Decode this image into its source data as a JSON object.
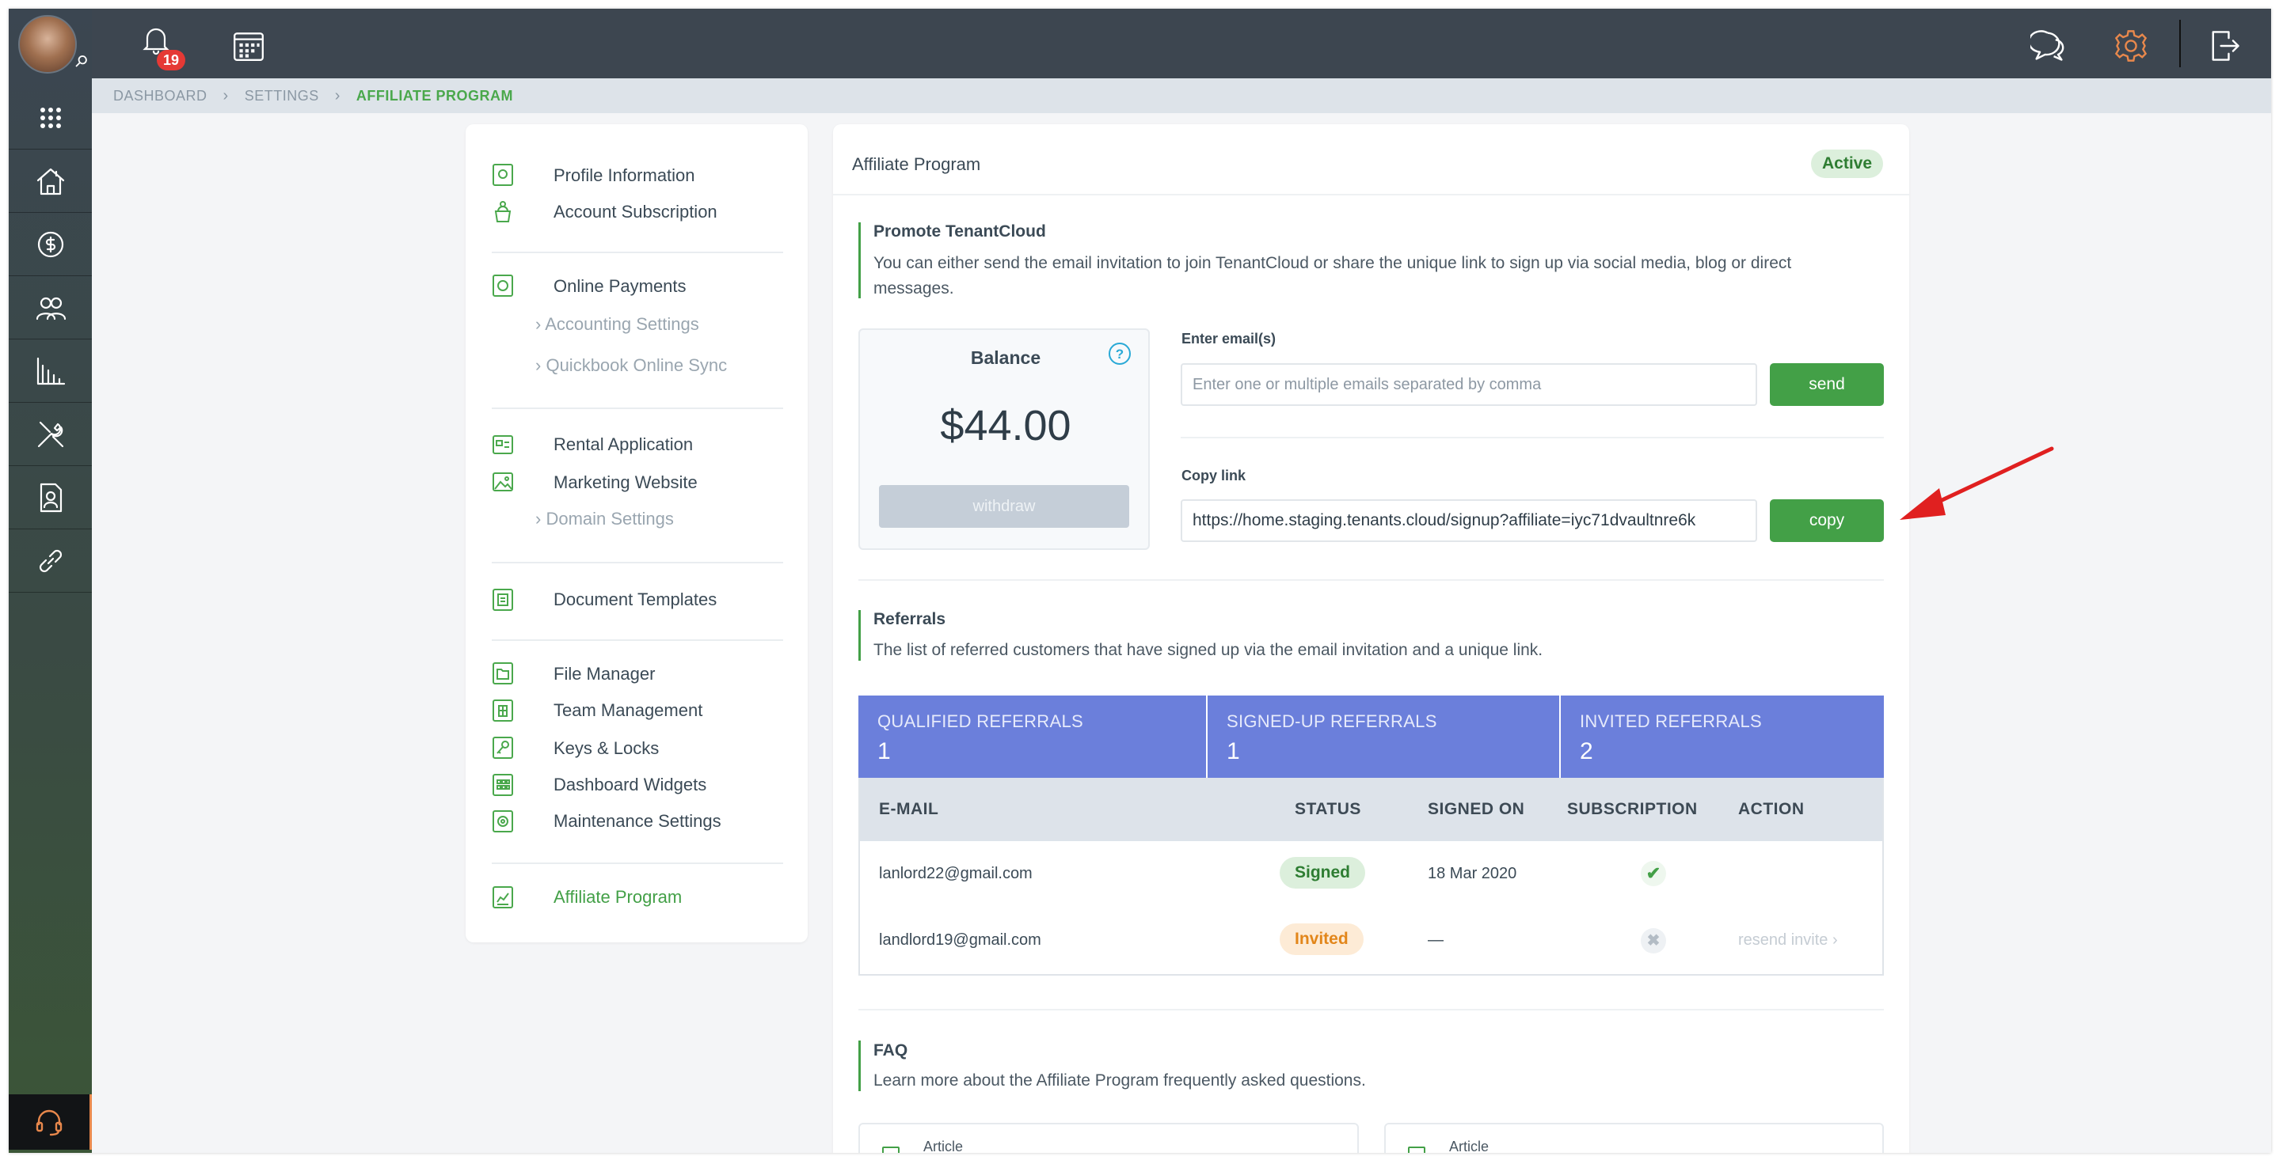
{
  "topbar": {
    "notification_count": "19",
    "icons": [
      "bell-icon",
      "calendar-icon",
      "chat-icon",
      "gear-icon",
      "logout-icon"
    ]
  },
  "sidebar": {
    "items": [
      "apps-grid-icon",
      "property-icon",
      "finance-icon",
      "people-icon",
      "reports-icon",
      "tools-icon",
      "documents-icon",
      "link-icon"
    ],
    "support_icon": "headset-icon"
  },
  "breadcrumb": {
    "items": [
      "DASHBOARD",
      "SETTINGS",
      "AFFILIATE PROGRAM"
    ]
  },
  "settings_menu": {
    "profile_information": "Profile Information",
    "account_subscription": "Account Subscription",
    "online_payments": "Online Payments",
    "accounting_settings": "Accounting Settings",
    "quickbook_online_sync": "Quickbook Online Sync",
    "rental_application": "Rental Application",
    "marketing_website": "Marketing Website",
    "domain_settings": "Domain Settings",
    "document_templates": "Document Templates",
    "file_manager": "File Manager",
    "team_management": "Team Management",
    "keys_locks": "Keys & Locks",
    "dashboard_widgets": "Dashboard Widgets",
    "maintenance_settings": "Maintenance Settings",
    "affiliate_program": "Affiliate Program"
  },
  "main": {
    "title": "Affiliate Program",
    "status_badge": "Active",
    "promote": {
      "title": "Promote TenantCloud",
      "description_line1": "You can either send the email invitation to join TenantCloud or share the unique link to sign up via social media, blog or direct",
      "description_line2": "messages."
    },
    "balance": {
      "label": "Balance",
      "help": "?",
      "amount": "$44.00",
      "withdraw": "withdraw"
    },
    "email": {
      "label": "Enter email(s)",
      "placeholder": "Enter one or multiple emails separated by comma",
      "send": "send"
    },
    "copy_link": {
      "label": "Copy link",
      "value": "https://home.staging.tenants.cloud/signup?affiliate=iyc71dvaultnre6k",
      "copy": "copy"
    },
    "referrals": {
      "title": "Referrals",
      "description": "The list of referred customers that have signed up via the email invitation and a unique link.",
      "stats": [
        {
          "label": "QUALIFIED REFERRALS",
          "value": "1"
        },
        {
          "label": "SIGNED-UP REFERRALS",
          "value": "1"
        },
        {
          "label": "INVITED REFERRALS",
          "value": "2"
        }
      ],
      "columns": [
        "E-MAIL",
        "STATUS",
        "SIGNED ON",
        "SUBSCRIPTION",
        "ACTION"
      ],
      "rows": [
        {
          "email": "lanlord22@gmail.com",
          "status": "Signed",
          "signed_on": "18 Mar 2020",
          "subscription": "check",
          "action": ""
        },
        {
          "email": "landlord19@gmail.com",
          "status": "Invited",
          "signed_on": "—",
          "subscription": "cross",
          "action": "resend invite"
        }
      ]
    },
    "faq": {
      "title": "FAQ",
      "description": "Learn more about the Affiliate Program frequently asked questions.",
      "articles": [
        "Article",
        "Article"
      ]
    }
  },
  "colors": {
    "accent_green": "#43a047",
    "stats_blue": "#6b7fdb",
    "arrow_red": "#e02020",
    "gear_orange": "#e8884c"
  }
}
